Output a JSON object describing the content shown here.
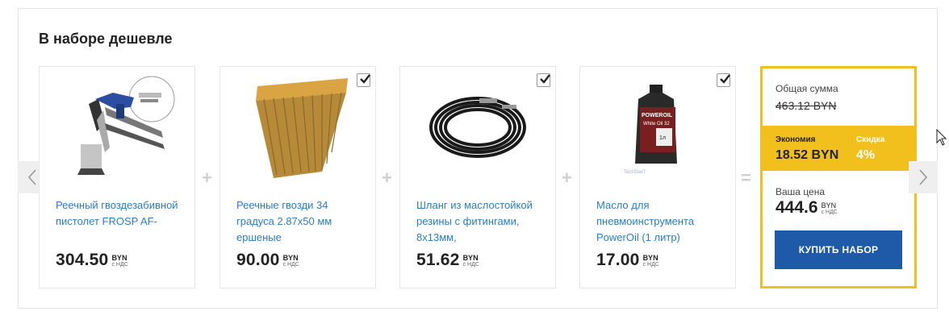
{
  "section_title": "В наборе дешевле",
  "currency": "BYN",
  "vat_note": "с НДС",
  "products": [
    {
      "name": "Реечный гвоздезабивной пистолет FROSP AF-",
      "price": "304.50",
      "checked": false,
      "icon": "nail-gun-icon"
    },
    {
      "name": "Реечные гвозди 34 градуса 2.87х50 мм ершеные",
      "price": "90.00",
      "checked": true,
      "icon": "nail-strip-icon"
    },
    {
      "name": "Шланг из маслостойкой резины с фитингами, 8х13мм,",
      "price": "51.62",
      "checked": true,
      "icon": "hose-icon"
    },
    {
      "name": "Масло для пневмоинструмента PowerOil (1 литр)",
      "price": "17.00",
      "checked": true,
      "icon": "oil-bottle-icon"
    }
  ],
  "operators": {
    "plus": "+",
    "equals": "="
  },
  "summary": {
    "total_label": "Общая сумма",
    "total_old": "463.12 BYN",
    "economy_label": "Экономия",
    "economy_value": "18.52 BYN",
    "discount_label": "Скидка",
    "discount_value": "4%",
    "your_price_label": "Ваша цена",
    "your_price": "444.6",
    "buy_button": "КУПИТЬ НАБОР"
  },
  "oil_label": {
    "brand": "POWEROIL",
    "line": "White Oil 32",
    "badge": "1л",
    "maker": "TechStarT"
  },
  "colors": {
    "accent": "#f2c01c",
    "button": "#1e5aa7",
    "link": "#2a7ec6"
  }
}
